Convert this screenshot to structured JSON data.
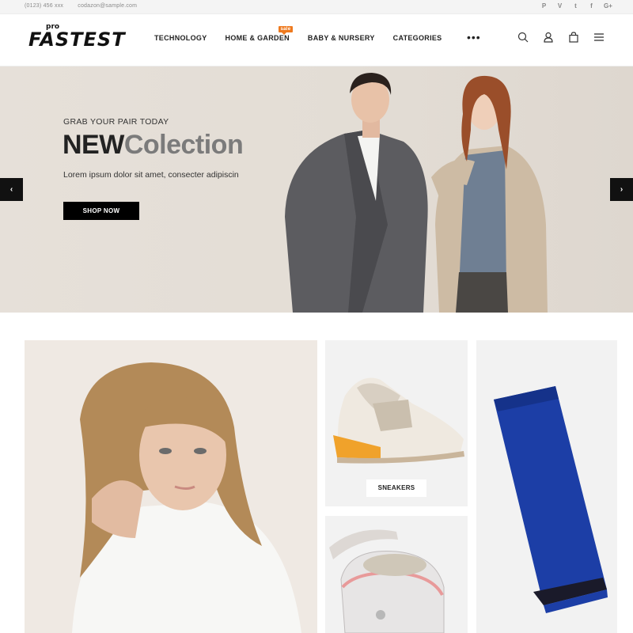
{
  "topbar": {
    "phone": "(0123) 456 xxx",
    "email": "codazon@sample.com",
    "social": [
      {
        "icon": "pinterest-icon",
        "glyph": "P"
      },
      {
        "icon": "vimeo-icon",
        "glyph": "V"
      },
      {
        "icon": "twitter-icon",
        "glyph": "t"
      },
      {
        "icon": "facebook-icon",
        "glyph": "f"
      },
      {
        "icon": "google-plus-icon",
        "glyph": "G+"
      }
    ]
  },
  "header": {
    "logo": {
      "text": "FASTEST",
      "superscript": "pro"
    },
    "nav": [
      {
        "label": "TECHNOLOGY"
      },
      {
        "label": "HOME & GARDEN",
        "badge": "sale"
      },
      {
        "label": "BABY & NURSERY"
      },
      {
        "label": "CATEGORIES"
      }
    ],
    "more": "•••",
    "icons": [
      "search-icon",
      "user-icon",
      "cart-icon",
      "menu-icon"
    ]
  },
  "hero": {
    "eyebrow": "GRAB YOUR PAIR TODAY",
    "title_bold": "NEW",
    "title_light": "Colection",
    "subtitle": "Lorem ipsum dolor sit amet, consecter adipiscin",
    "cta": "SHOP NOW",
    "prev": "‹",
    "next": "›"
  },
  "banners": {
    "sneakers_label": "SNEAKERS"
  },
  "colors": {
    "accent": "#ee7a1f",
    "dark": "#111111",
    "hero_bg": "#e4ded6",
    "scarf": "#1c3ea6"
  }
}
